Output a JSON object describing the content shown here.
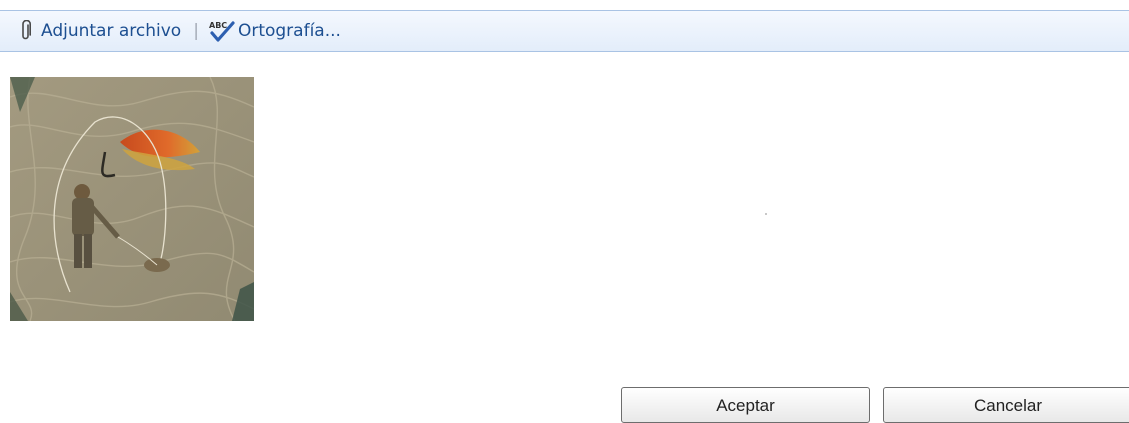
{
  "toolbar": {
    "attach_label": "Adjuntar archivo",
    "separator": "|",
    "spelling_label": "Ortografía...",
    "spelling_icon_text": "ABC",
    "attach_icon": "paperclip-icon",
    "spelling_icon": "spell-check-icon"
  },
  "dialog": {
    "ok_label": "Aceptar",
    "cancel_label": "Cancelar"
  },
  "colors": {
    "toolbar_text": "#1d4f91",
    "toolbar_border": "#a9c3e4"
  }
}
